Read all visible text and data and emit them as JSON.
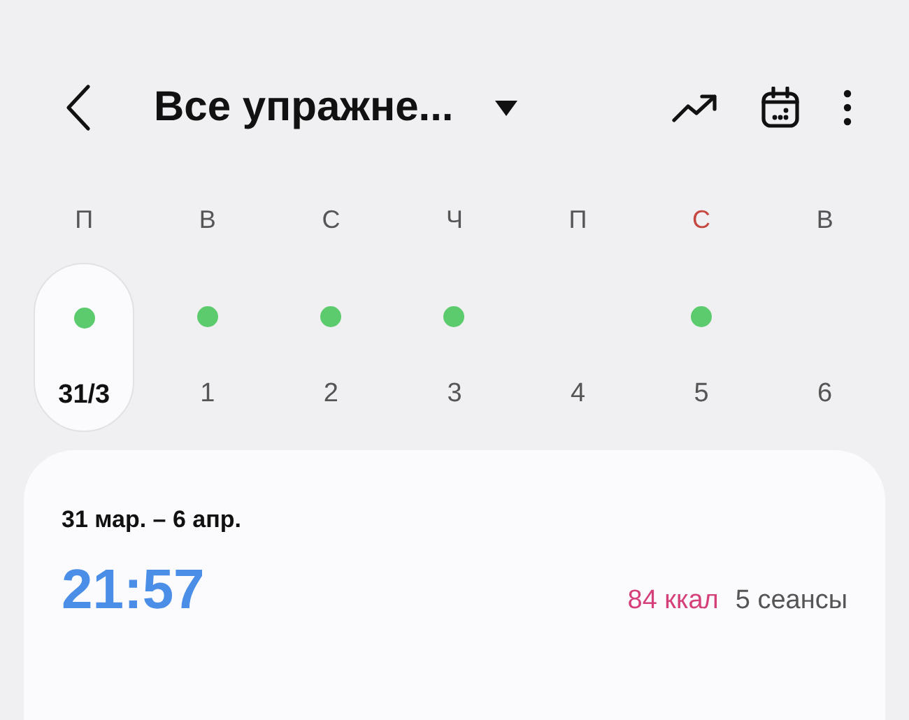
{
  "header": {
    "title": "Все упражне..."
  },
  "days": [
    {
      "letter": "П",
      "number": "31/3",
      "active": true,
      "selected": true,
      "holiday": false
    },
    {
      "letter": "В",
      "number": "1",
      "active": true,
      "selected": false,
      "holiday": false
    },
    {
      "letter": "С",
      "number": "2",
      "active": true,
      "selected": false,
      "holiday": false
    },
    {
      "letter": "Ч",
      "number": "3",
      "active": true,
      "selected": false,
      "holiday": false
    },
    {
      "letter": "П",
      "number": "4",
      "active": false,
      "selected": false,
      "holiday": false
    },
    {
      "letter": "С",
      "number": "5",
      "active": true,
      "selected": false,
      "holiday": true
    },
    {
      "letter": "В",
      "number": "6",
      "active": false,
      "selected": false,
      "holiday": false
    }
  ],
  "summary": {
    "range": "31 мар. – 6 апр.",
    "duration": "21:57",
    "calories": "84 ккал",
    "sessions": "5 сеансы"
  }
}
